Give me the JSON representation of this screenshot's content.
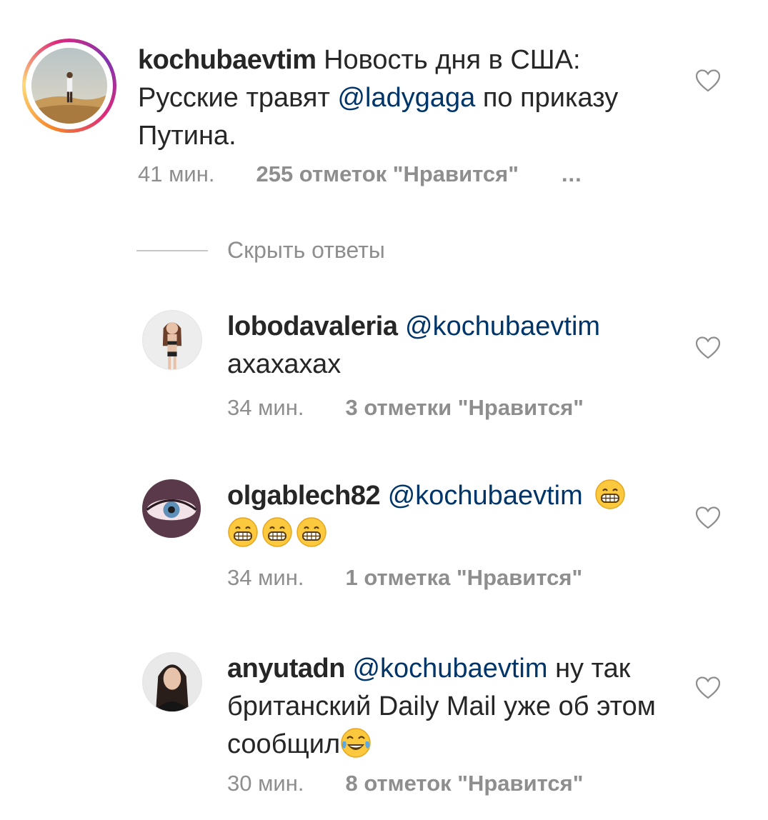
{
  "main_comment": {
    "username": "kochubaevtim",
    "text_before": " Новость дня в США: Русские травят ",
    "mention": "@ladygaga",
    "text_after": " по приказу Путина.",
    "time": "41 мин.",
    "likes": "255 отметок \"Нравится\"",
    "more": "..."
  },
  "hide_replies_label": "Скрыть ответы",
  "replies": [
    {
      "username": "lobodavaleria",
      "mention": "@kochubaevtim",
      "text": "ахахахах",
      "time": "34 мин.",
      "likes": "3 отметки \"Нравится\""
    },
    {
      "username": "olgablech82",
      "mention": "@kochubaevtim",
      "emoji": "grinning-face-with-smiling-eyes",
      "time": "34 мин.",
      "likes": "1 отметка \"Нравится\""
    },
    {
      "username": "anyutadn",
      "mention": "@kochubaevtim",
      "text": " ну так британский Daily Mail уже об этом сообщил",
      "emoji": "face-with-tears-of-joy",
      "time": "30 мин.",
      "likes": "8 отметок \"Нравится\""
    }
  ],
  "colors": {
    "mention": "#003569",
    "meta": "#8e8e8e",
    "text": "#262626"
  }
}
